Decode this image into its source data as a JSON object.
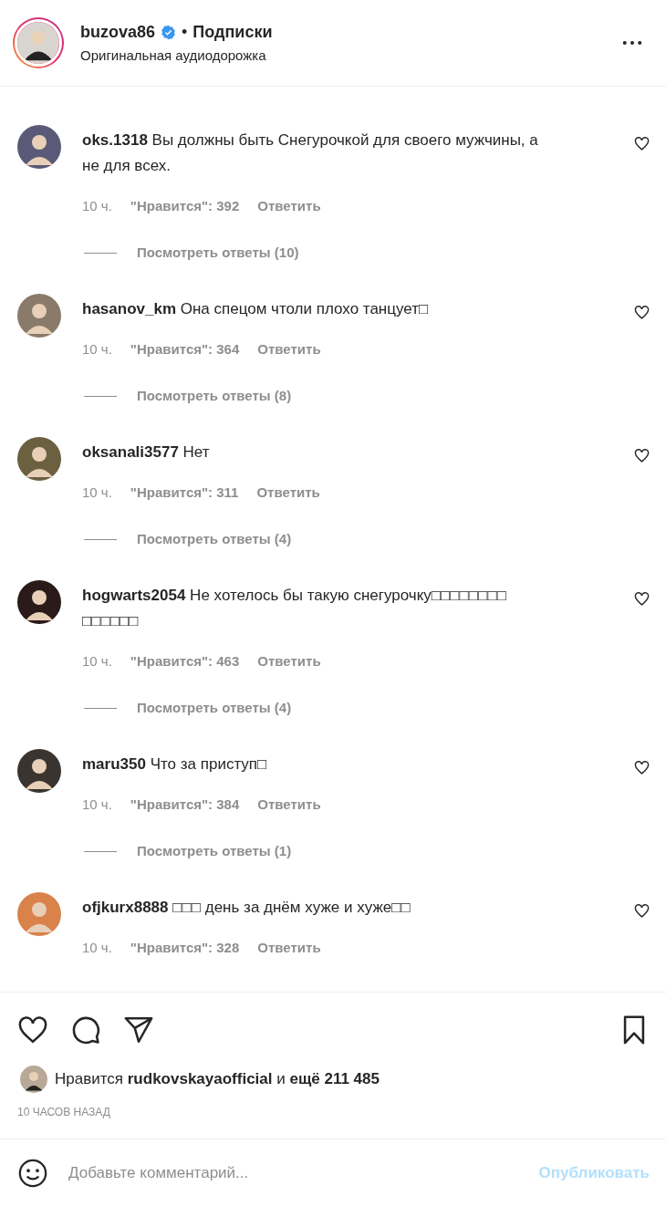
{
  "header": {
    "username": "buzova86",
    "verified": true,
    "separator": "•",
    "follow_label": "Подписки",
    "subtitle": "Оригинальная аудиодорожка"
  },
  "comments": [
    {
      "text": "**oks.1318** Вы должны быть Снегурочкой для своего мужчины, а не для всех.",
      "color": "#5a5a78",
      "time": "10 ч.",
      "likes": "\"Нравится\": 392",
      "reply": "Ответить",
      "replies": "Посмотреть ответы (10)"
    },
    {
      "text": "**hasanov_km** Она спецом чтоли плохо танцует□",
      "color": "#8a7a6a",
      "time": "10 ч.",
      "likes": "\"Нравится\": 364",
      "reply": "Ответить",
      "replies": "Посмотреть ответы (8)"
    },
    {
      "text": "**oksanali3577** Нет",
      "color": "#6b6040",
      "time": "10 ч.",
      "likes": "\"Нравится\": 311",
      "reply": "Ответить",
      "replies": "Посмотреть ответы (4)"
    },
    {
      "text": "**hogwarts2054** Не хотелось бы такую снегурочку□□□□□□□□ □□□□□□",
      "color": "#2a1a1a",
      "time": "10 ч.",
      "likes": "\"Нравится\": 463",
      "reply": "Ответить",
      "replies": "Посмотреть ответы (4)"
    },
    {
      "text": "**maru350** Что за приступ□",
      "color": "#3a3430",
      "time": "10 ч.",
      "likes": "\"Нравится\": 384",
      "reply": "Ответить",
      "replies": "Посмотреть ответы (1)"
    },
    {
      "text": "**ofjkurx8888** □□□ день за днём хуже и хуже□□",
      "color": "#d9824a",
      "time": "10 ч.",
      "likes": "\"Нравится\": 328",
      "reply": "Ответить"
    }
  ],
  "likes": {
    "text": "Нравится **rudkovskayaofficial** и **ещё 211 485**"
  },
  "timestamp": "10 ЧАСОВ НАЗАД",
  "composer": {
    "placeholder": "Добавьте комментарий...",
    "post_label": "Опубликовать",
    "disabled": true
  }
}
